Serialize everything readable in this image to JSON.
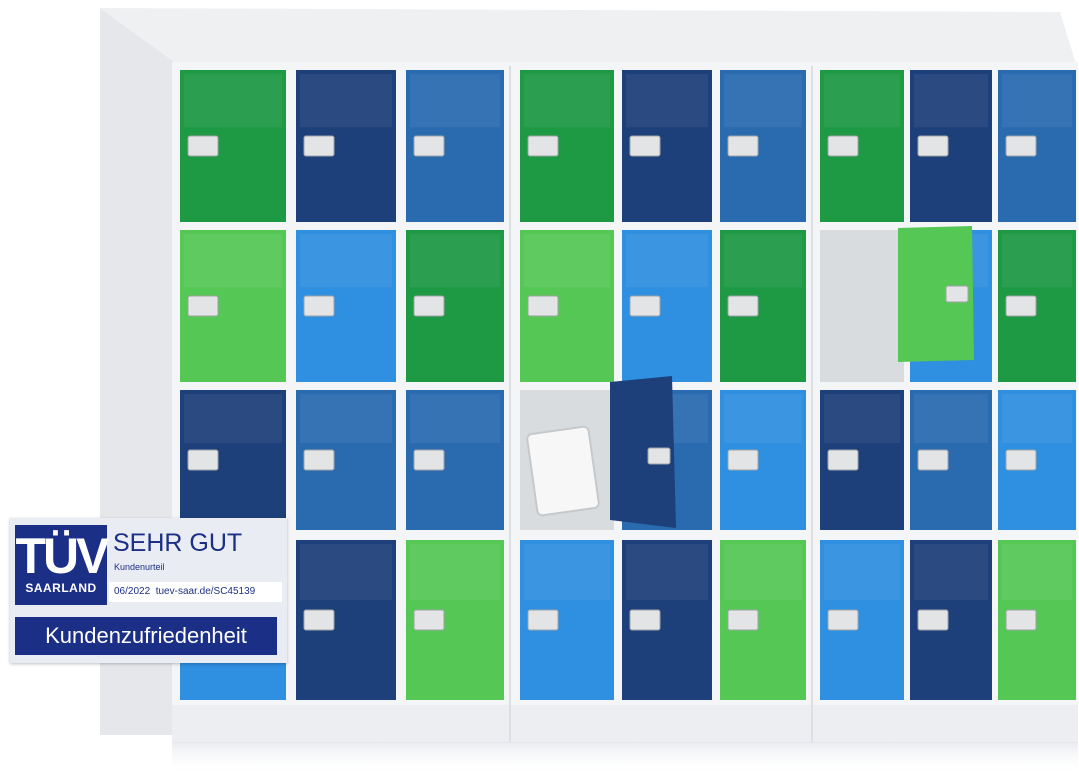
{
  "badge": {
    "logo_text": "TÜV",
    "region": "SAARLAND",
    "rating": "SEHR GUT",
    "rating_sub": "Kundenurteil",
    "date": "06/2022",
    "certificate": "tuev-saar.de/SC45139",
    "category": "Kundenzufriedenheit"
  },
  "colors": {
    "dark_green": "#1e9a45",
    "light_green": "#55c755",
    "navy": "#1d3f7a",
    "steel_blue": "#2a6bb0",
    "sky_blue": "#2f8fe0",
    "cabinet": "#f2f3f5",
    "badge_blue": "#1c2f86"
  }
}
